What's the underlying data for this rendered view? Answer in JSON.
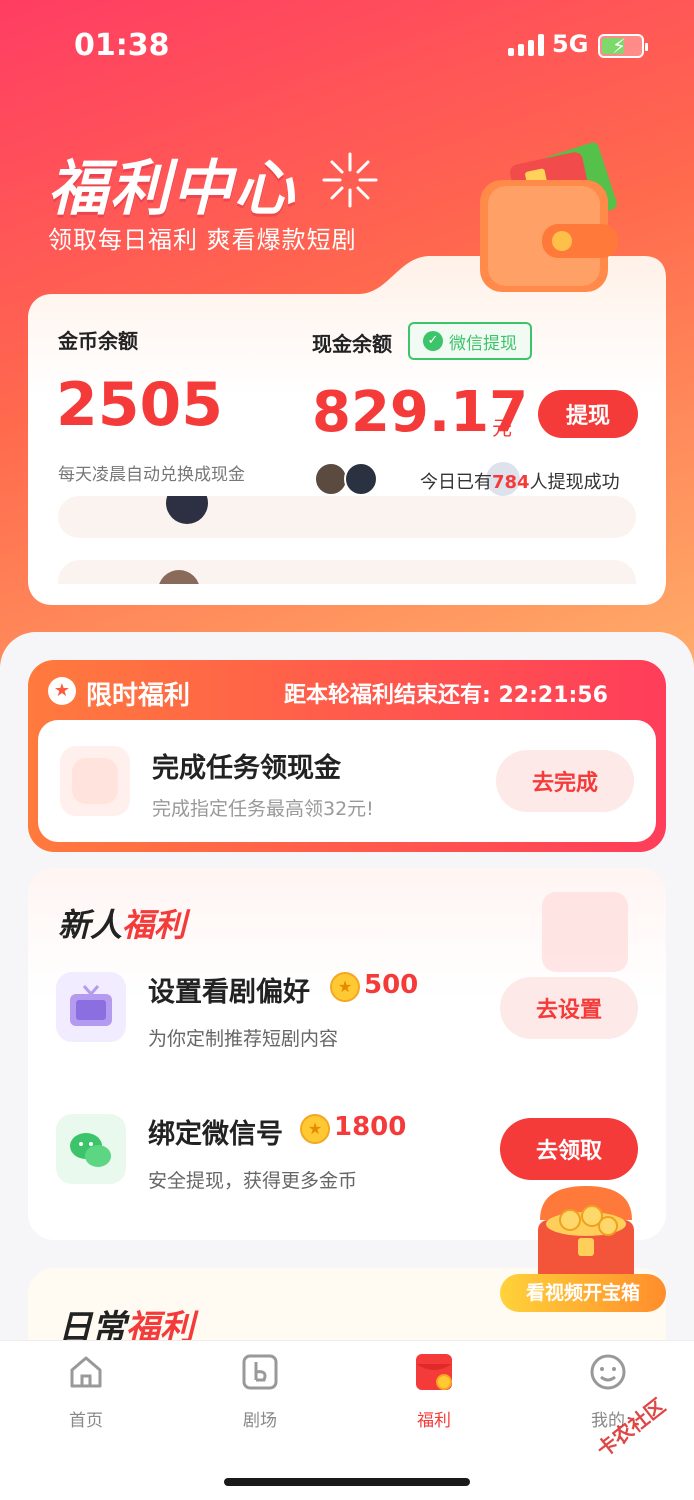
{
  "status_bar": {
    "time": "01:38",
    "network": "5G"
  },
  "hero": {
    "title": "福利中心",
    "subtitle": "领取每日福利 爽看爆款短剧"
  },
  "balance": {
    "coin_label": "金币余额",
    "coin_value": "2505",
    "coin_note": "每天凌晨自动兑换成现金",
    "cash_label": "现金余额",
    "wechat_tag": "微信提现",
    "cash_value": "829.17",
    "cash_unit": "元",
    "withdraw_button": "提现",
    "today_prefix": "今日已有",
    "today_count": "784",
    "today_suffix": "人提现成功"
  },
  "limited": {
    "title": "限时福利",
    "countdown_label": "距本轮福利结束还有:",
    "countdown": "22:21:56",
    "task_title": "完成任务领现金",
    "task_desc": "完成指定任务最高领32元!",
    "task_button": "去完成"
  },
  "newbie": {
    "title_prefix": "新人",
    "title_highlight": "福利",
    "items": [
      {
        "title": "设置看剧偏好",
        "reward": "500",
        "desc": "为你定制推荐短剧内容",
        "button": "去设置"
      },
      {
        "title": "绑定微信号",
        "reward": "1800",
        "desc": "安全提现，获得更多金币",
        "button": "去领取"
      }
    ]
  },
  "daily": {
    "title_prefix": "日常",
    "title_highlight": "福利",
    "chest_label": "看视频开宝箱"
  },
  "tabs": [
    {
      "label": "首页"
    },
    {
      "label": "剧场"
    },
    {
      "label": "福利"
    },
    {
      "label": "我的"
    }
  ],
  "watermark": "卡农社区",
  "colors": {
    "accent": "#f53a3a",
    "wechat": "#3cc46a"
  }
}
